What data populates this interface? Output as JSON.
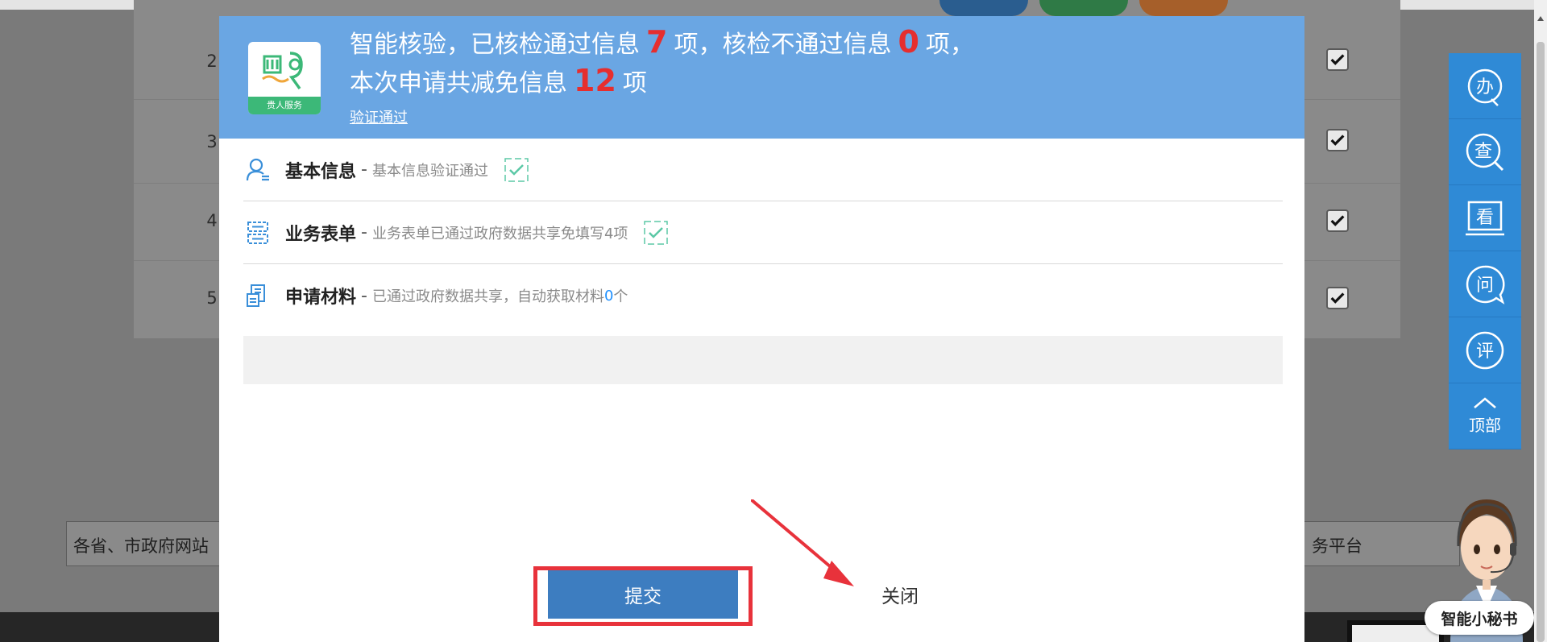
{
  "background": {
    "row_numbers": [
      "2",
      "3",
      "4",
      "5"
    ],
    "links_left": "各省、市政府网站",
    "links_right": "务平台"
  },
  "modal": {
    "header": {
      "line1_a": "智能核验，已核检通过信息",
      "line1_num1": "7",
      "line1_b": "项，核检不通过信息",
      "line1_num2": "0",
      "line1_c": "项，",
      "line2_a": "本次申请共减免信息",
      "line2_num": "12",
      "line2_b": "项",
      "link": "验证通过",
      "logo_ribbon": "贵人服务"
    },
    "rows": [
      {
        "icon": "user-icon",
        "title": "基本信息",
        "sep": "-",
        "desc": "基本信息验证通过"
      },
      {
        "icon": "form-icon",
        "title": "业务表单",
        "sep": "-",
        "desc": "业务表单已通过政府数据共享免填写4项"
      },
      {
        "icon": "document-icon",
        "title": "申请材料",
        "sep": "-",
        "desc": "已通过政府数据共享，自动获取材料",
        "count": "0",
        "tail": "个"
      }
    ],
    "buttons": {
      "submit": "提交",
      "close": "关闭"
    }
  },
  "toolbar": {
    "items": [
      {
        "icon": "handle-icon",
        "glyph": "办"
      },
      {
        "icon": "query-icon",
        "glyph": "查"
      },
      {
        "icon": "view-icon",
        "glyph": "看"
      },
      {
        "icon": "ask-icon",
        "glyph": "问"
      },
      {
        "icon": "rate-icon",
        "glyph": "评"
      }
    ],
    "top_label": "顶部"
  },
  "assistant": {
    "label": "智能小秘书"
  },
  "colors": {
    "header_bg": "#6aa6e3",
    "highlight_red": "#e62e2e",
    "submit_bg": "#3d7dc0",
    "toolbar_bg": "#2f8ad6",
    "check_green": "#5bc8a6"
  }
}
